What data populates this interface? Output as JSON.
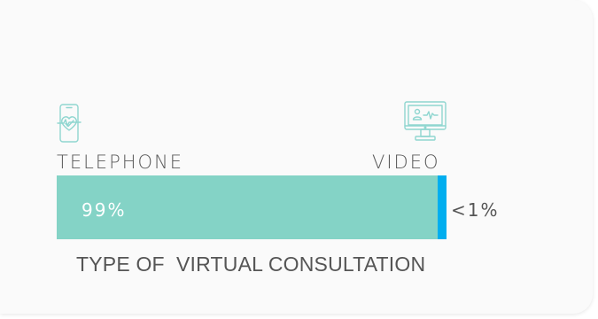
{
  "chart_data": {
    "type": "bar",
    "orientation": "horizontal-stacked",
    "categories": [
      "TELEPHONE",
      "VIDEO"
    ],
    "values": [
      99,
      1
    ],
    "value_labels": [
      "99%",
      "<1%"
    ],
    "xlabel": "TYPE OF  VIRTUAL CONSULTATION",
    "colors": [
      "#84d3c6",
      "#00aeef"
    ],
    "icons": [
      "phone-heart-icon",
      "monitor-telehealth-icon"
    ],
    "grid": false
  },
  "colors": {
    "icon_stroke": "#8fd6d0",
    "text": "#555555",
    "card_bg": "#fafafa"
  }
}
